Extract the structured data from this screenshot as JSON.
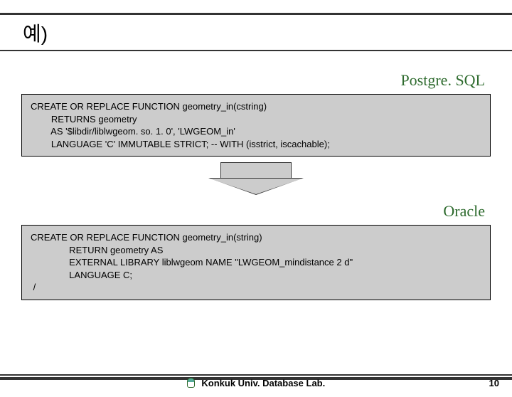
{
  "title": "예)",
  "labels": {
    "postgresql": "Postgre. SQL",
    "oracle": "Oracle"
  },
  "code": {
    "postgresql": "CREATE OR REPLACE FUNCTION geometry_in(cstring)\n        RETURNS geometry\n        AS '$libdir/liblwgeom. so. 1. 0', 'LWGEOM_in'\n        LANGUAGE 'C' IMMUTABLE STRICT; -- WITH (isstrict, iscachable);",
    "oracle": "CREATE OR REPLACE FUNCTION geometry_in(string)\n               RETURN geometry AS\n               EXTERNAL LIBRARY liblwgeom NAME \"LWGEOM_mindistance 2 d\"\n               LANGUAGE C;\n /"
  },
  "footer": {
    "text": "Konkuk Univ. Database Lab.",
    "page": "10"
  }
}
